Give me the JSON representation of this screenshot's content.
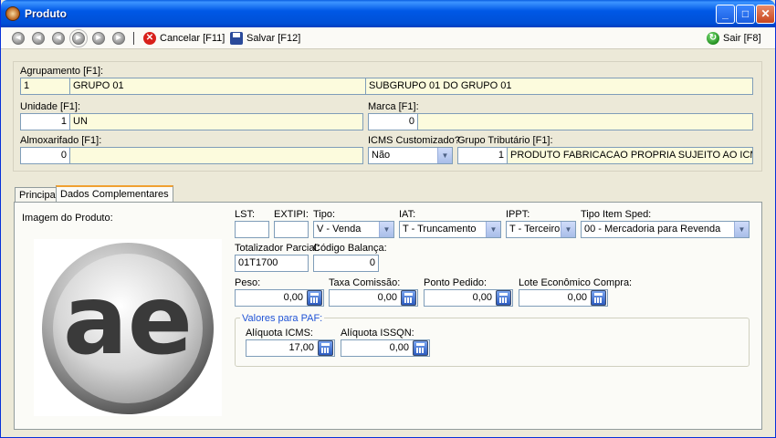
{
  "window": {
    "title": "Produto"
  },
  "toolbar": {
    "cancel_label": "Cancelar [F11]",
    "save_label": "Salvar [F12]",
    "exit_label": "Sair [F8]"
  },
  "agrupamento": {
    "label": "Agrupamento [F1]:",
    "code": "1",
    "group": "GRUPO 01",
    "subgroup": "SUBGRUPO 01 DO GRUPO 01"
  },
  "unidade": {
    "label": "Unidade [F1]:",
    "code": "1",
    "name": "UN"
  },
  "marca": {
    "label": "Marca [F1]:",
    "code": "0",
    "name": ""
  },
  "almoxarifado": {
    "label": "Almoxarifado [F1]:",
    "code": "0",
    "name": ""
  },
  "icms_customizado": {
    "label": "ICMS Customizado?",
    "value": "Não"
  },
  "grupo_tributario": {
    "label": "Grupo Tributário [F1]:",
    "code": "1",
    "name": "PRODUTO FABRICACAO PROPRIA SUJEITO AO ICMS ST"
  },
  "tabs": [
    {
      "label": "Principal"
    },
    {
      "label": "Dados Complementares"
    }
  ],
  "complementares": {
    "image_label": "Imagem do Produto:",
    "lst_label": "LST:",
    "lst_value": "",
    "extipi_label": "EXTIPI:",
    "extipi_value": "",
    "tipo_label": "Tipo:",
    "tipo_value": "V - Venda",
    "iat_label": "IAT:",
    "iat_value": "T - Truncamento",
    "ippt_label": "IPPT:",
    "ippt_value": "T - Terceiro",
    "tipo_sped_label": "Tipo Item Sped:",
    "tipo_sped_value": "00 - Mercadoria para Revenda",
    "totalizador_label": "Totalizador Parcial:",
    "totalizador_value": "01T1700",
    "codigo_balanca_label": "Código Balança:",
    "codigo_balanca_value": "0",
    "peso_label": "Peso:",
    "peso_value": "0,00",
    "taxa_comissao_label": "Taxa Comissão:",
    "taxa_comissao_value": "0,00",
    "ponto_pedido_label": "Ponto Pedido:",
    "ponto_pedido_value": "0,00",
    "lote_label": "Lote Econômico Compra:",
    "lote_value": "0,00"
  },
  "paf": {
    "title": "Valores para PAF:",
    "icms_label": "Alíquota ICMS:",
    "icms_value": "17,00",
    "issqn_label": "Alíquota ISSQN:",
    "issqn_value": "0,00"
  },
  "logo": {
    "text": "ae"
  }
}
